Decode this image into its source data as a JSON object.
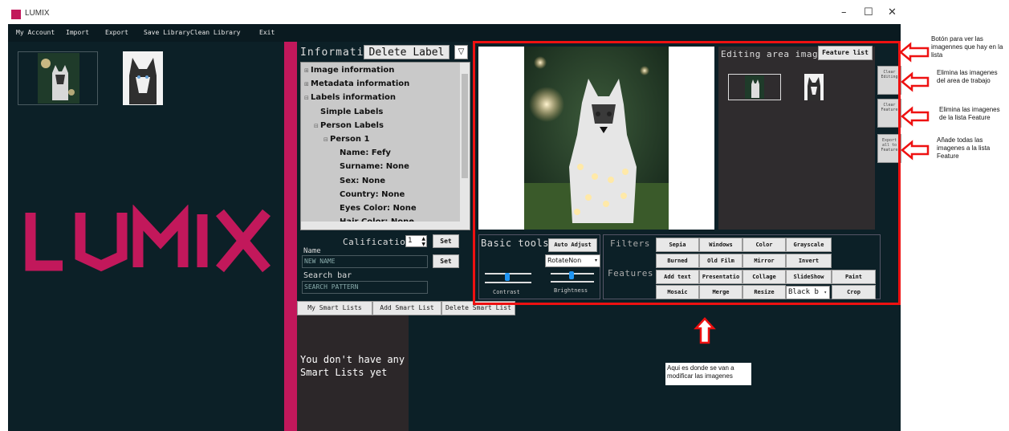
{
  "window": {
    "title": "LUMIX",
    "controls": [
      "–",
      "☐",
      "✕"
    ]
  },
  "menu": [
    "My Account",
    "Import",
    "Export",
    "Save Library",
    "Clean Library",
    "Exit"
  ],
  "brand": {
    "logo_text": "LUMIX",
    "accent": "#c2185b"
  },
  "info_panel": {
    "header": "Information",
    "delete_label": "Delete Label",
    "tree": [
      {
        "label": "Image information",
        "indent": 0,
        "expander": "+"
      },
      {
        "label": "Metadata information",
        "indent": 0,
        "expander": "+"
      },
      {
        "label": "Labels information",
        "indent": 0,
        "expander": "−"
      },
      {
        "label": "Simple Labels",
        "indent": 1,
        "expander": ""
      },
      {
        "label": "Person Labels",
        "indent": 1,
        "expander": "−"
      },
      {
        "label": "Person 1",
        "indent": 2,
        "expander": "−"
      },
      {
        "label": "Name: Fefy",
        "indent": 3,
        "expander": ""
      },
      {
        "label": "Surname: None",
        "indent": 3,
        "expander": ""
      },
      {
        "label": "Sex: None",
        "indent": 3,
        "expander": ""
      },
      {
        "label": "Country: None",
        "indent": 3,
        "expander": ""
      },
      {
        "label": "Eyes Color: None",
        "indent": 3,
        "expander": ""
      },
      {
        "label": "Hair Color: None",
        "indent": 3,
        "expander": ""
      }
    ],
    "calification_label": "Calification",
    "calification_value": "1",
    "set_label": "Set",
    "name_label": "Name",
    "name_placeholder": "NEW NAME",
    "search_label": "Search bar",
    "search_placeholder": "SEARCH PATTERN"
  },
  "smart_lists": {
    "tabs": [
      "My Smart Lists",
      "Add Smart List",
      "Delete Smart List"
    ],
    "empty_message": "You don't have any Smart Lists yet"
  },
  "editing": {
    "images_title": "Editing area images",
    "feature_list_button": "Feature list",
    "side_buttons": [
      "Clear Editing",
      "Clear Feature",
      "Export all to Feature"
    ],
    "basic_tools_title": "Basic tools",
    "auto_adjust": "Auto Adjust",
    "rotate_value": "RotateNon",
    "contrast_label": "Contrast",
    "brightness_label": "Brightness",
    "filters_title": "Filters",
    "features_title": "Features",
    "filters_row1": [
      "Sepia",
      "Windows",
      "Color",
      "Grayscale"
    ],
    "filters_row2": [
      "Burned",
      "Old Film",
      "Mirror",
      "Invert"
    ],
    "features_row1": [
      "Add text",
      "Presentatio",
      "Collage",
      "SlideShow",
      "Paint"
    ],
    "features_row2": [
      "Mosaic",
      "Merge",
      "Resize",
      "Crop"
    ],
    "select_value": "Black b"
  },
  "annotations": {
    "feature_list": "Botón para ver las imagennes que hay en la lista",
    "clear_editing": "Elimina las imagenes del area de trabajo",
    "clear_feature": "Elimina las imagenes de la lista Feature",
    "export_all": "Añade todas las imagenes a la lista Feature",
    "modify_area": "Aqui es donde se van a modificar las imagenes"
  }
}
